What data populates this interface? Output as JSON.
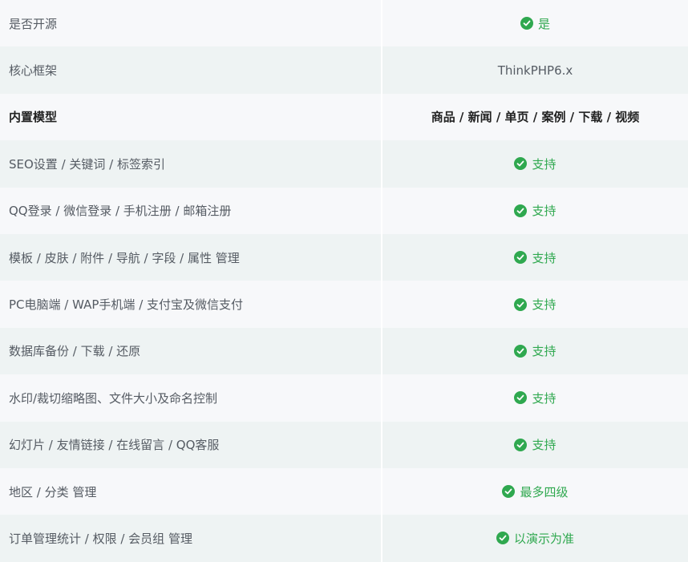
{
  "rows": [
    {
      "label": "是否开源",
      "value": "是",
      "type": "check"
    },
    {
      "label": "核心框架",
      "value": "ThinkPHP6.x",
      "type": "plain"
    },
    {
      "label": "内置模型",
      "value": "商品 / 新闻 / 单页 / 案例 / 下载 / 视频",
      "type": "bold"
    },
    {
      "label": "SEO设置 / 关键词 / 标签索引",
      "value": "支持",
      "type": "check"
    },
    {
      "label": "QQ登录 / 微信登录 / 手机注册 / 邮箱注册",
      "value": "支持",
      "type": "check"
    },
    {
      "label": "模板 / 皮肤 / 附件 / 导航 / 字段 / 属性 管理",
      "value": "支持",
      "type": "check"
    },
    {
      "label": "PC电脑端 / WAP手机端 / 支付宝及微信支付",
      "value": "支持",
      "type": "check"
    },
    {
      "label": "数据库备份 / 下载 / 还原",
      "value": "支持",
      "type": "check"
    },
    {
      "label": "水印/裁切缩略图、文件大小及命名控制",
      "value": "支持",
      "type": "check"
    },
    {
      "label": "幻灯片 / 友情链接 / 在线留言 / QQ客服",
      "value": "支持",
      "type": "check"
    },
    {
      "label": "地区 / 分类 管理",
      "value": "最多四级",
      "type": "check"
    },
    {
      "label": "订单管理统计 / 权限 / 会员组 管理",
      "value": "以演示为准",
      "type": "check"
    }
  ],
  "colors": {
    "green": "#2fa84f",
    "row_odd": "#f7f8fa",
    "row_even": "#eef3f3"
  },
  "icons": {
    "check": "check-circle-icon"
  }
}
